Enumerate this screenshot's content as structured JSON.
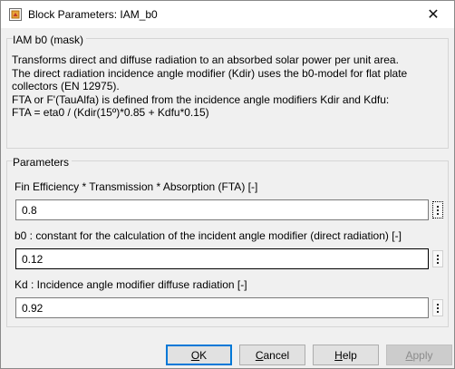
{
  "window": {
    "title": "Block Parameters: IAM_b0",
    "close_glyph": "✕",
    "icon": "simulink-block-icon"
  },
  "mask_group": {
    "label": "IAM b0 (mask)",
    "description_lines": [
      "Transforms direct and diffuse radiation to an absorbed solar power per unit area.",
      "The direct radiation incidence angle modifier (Kdir) uses the b0-model for flat plate",
      "collectors (EN 12975).",
      "FTA or F'(TauAlfa) is defined from the incidence angle modifiers Kdir and Kdfu:",
      "FTA = eta0 / (Kdir(15º)*0.85 + Kdfu*0.15)"
    ]
  },
  "parameters_group": {
    "label": "Parameters",
    "params": [
      {
        "label": "Fin Efficiency * Transmission * Absorption (FTA) [-]",
        "value": "0.8"
      },
      {
        "label": "b0 : constant for the calculation of the incident angle modifier (direct radiation) [-]",
        "value": "0.12"
      },
      {
        "label": "Kd : Incidence angle modifier diffuse radiation [-]",
        "value": "0.92"
      }
    ]
  },
  "buttons": {
    "ok": {
      "prefix": "",
      "hotkey": "O",
      "suffix": "K"
    },
    "cancel": {
      "prefix": "",
      "hotkey": "C",
      "suffix": "ancel"
    },
    "help": {
      "prefix": "",
      "hotkey": "H",
      "suffix": "elp"
    },
    "apply": {
      "prefix": "",
      "hotkey": "A",
      "suffix": "pply"
    }
  },
  "colors": {
    "default_button_border": "#0078d7",
    "window_bg": "#f0f0f0"
  }
}
